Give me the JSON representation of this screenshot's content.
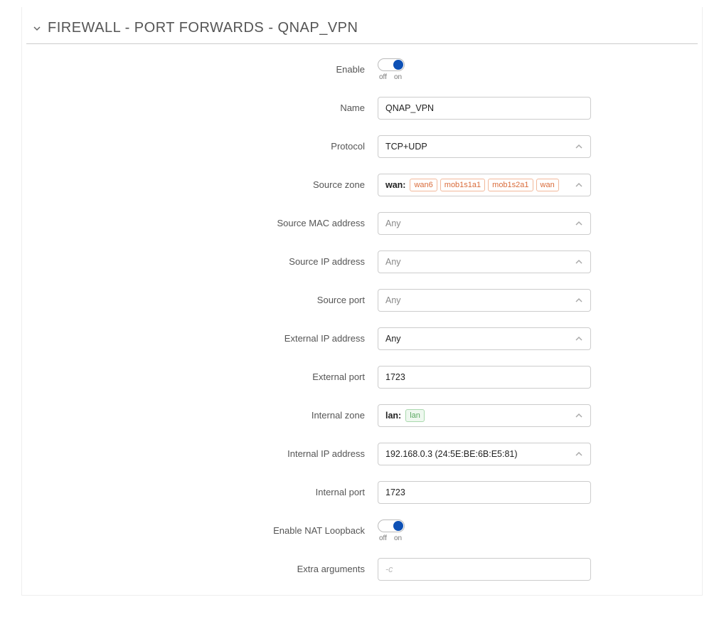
{
  "header": {
    "title": "FIREWALL - PORT FORWARDS - QNAP_VPN"
  },
  "toggle_labels": {
    "off": "off",
    "on": "on"
  },
  "fields": {
    "enable": {
      "label": "Enable"
    },
    "name": {
      "label": "Name",
      "value": "QNAP_VPN"
    },
    "protocol": {
      "label": "Protocol",
      "value": "TCP+UDP"
    },
    "source_zone": {
      "label": "Source zone",
      "zone": "wan:",
      "tags": [
        "wan6",
        "mob1s1a1",
        "mob1s2a1",
        "wan"
      ]
    },
    "source_mac": {
      "label": "Source MAC address",
      "value": "Any"
    },
    "source_ip": {
      "label": "Source IP address",
      "value": "Any"
    },
    "source_port": {
      "label": "Source port",
      "value": "Any"
    },
    "external_ip": {
      "label": "External IP address",
      "value": "Any"
    },
    "external_port": {
      "label": "External port",
      "value": "1723"
    },
    "internal_zone": {
      "label": "Internal zone",
      "zone": "lan:",
      "tags": [
        "lan"
      ]
    },
    "internal_ip": {
      "label": "Internal IP address",
      "value": "192.168.0.3 (24:5E:BE:6B:E5:81)"
    },
    "internal_port": {
      "label": "Internal port",
      "value": "1723"
    },
    "nat_loopback": {
      "label": "Enable NAT Loopback"
    },
    "extra_args": {
      "label": "Extra arguments",
      "placeholder": "-c"
    }
  }
}
